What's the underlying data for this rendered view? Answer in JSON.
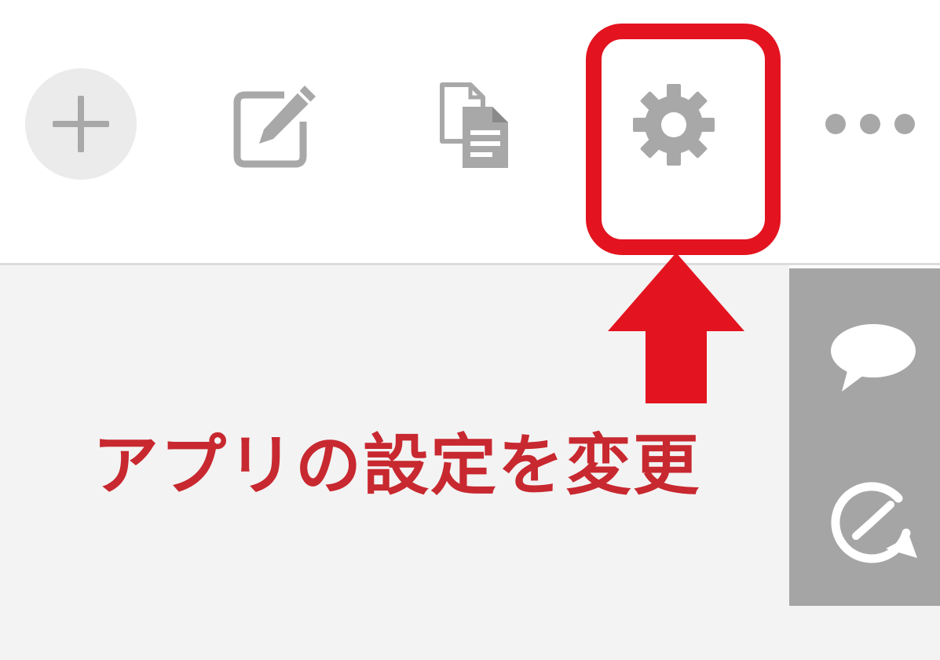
{
  "toolbar": {
    "buttons": [
      {
        "id": "add",
        "icon": "plus-icon"
      },
      {
        "id": "edit",
        "icon": "edit-icon"
      },
      {
        "id": "copy",
        "icon": "copy-document-icon"
      },
      {
        "id": "settings",
        "icon": "gear-icon"
      },
      {
        "id": "more",
        "icon": "more-dots-icon"
      }
    ],
    "icon_color": "#a8a8a8"
  },
  "side_panel": {
    "buttons": [
      {
        "id": "comment",
        "icon": "comment-bubble-icon"
      },
      {
        "id": "history",
        "icon": "history-clock-icon"
      }
    ],
    "background": "#a5a5a5",
    "icon_color": "#ffffff"
  },
  "annotation": {
    "text": "アプリの設定を変更",
    "color": "#c8282f",
    "highlight_color": "#e3141f",
    "arrow_color": "#e3141f"
  },
  "colors": {
    "content_background": "#f3f3f3",
    "toolbar_background": "#ffffff"
  }
}
